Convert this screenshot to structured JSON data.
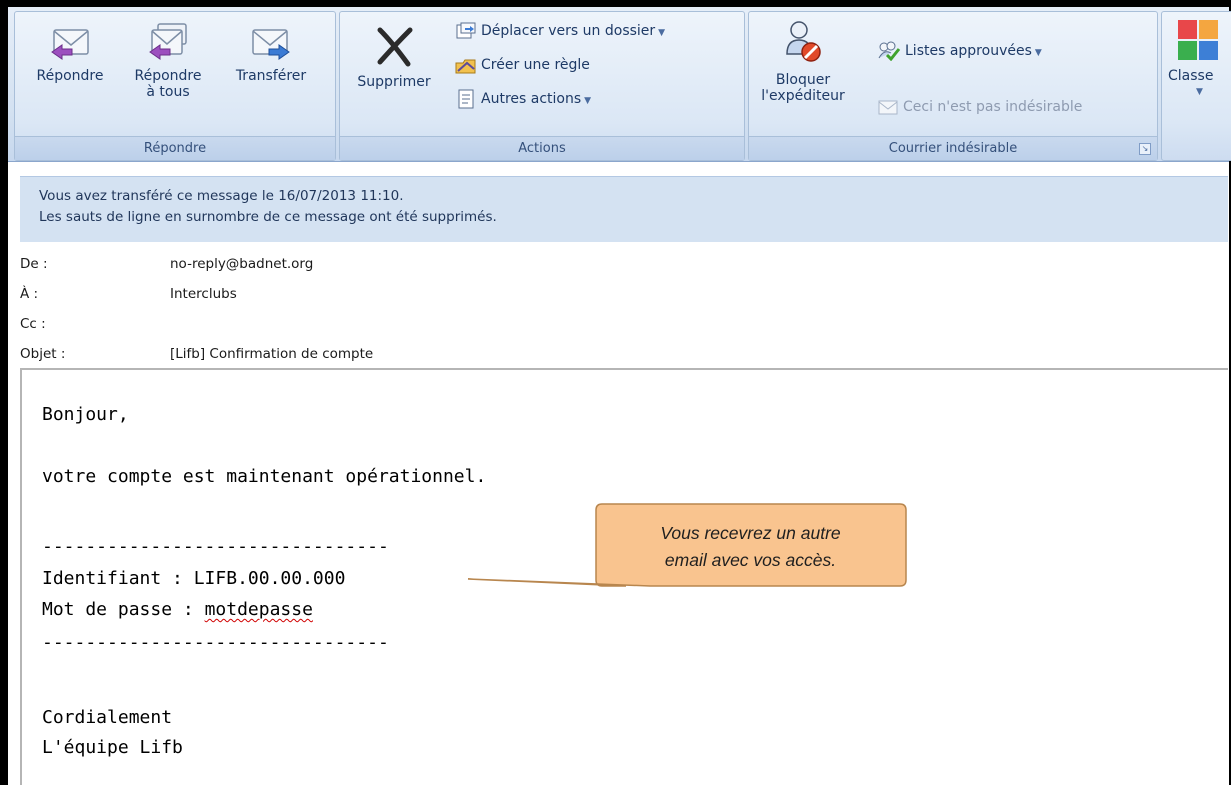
{
  "ribbon": {
    "groups": {
      "respond": {
        "title": "Répondre",
        "reply": "Répondre",
        "reply_all_line1": "Répondre",
        "reply_all_line2": "à tous",
        "forward": "Transférer"
      },
      "actions": {
        "title": "Actions",
        "delete": "Supprimer",
        "move_to_folder": "Déplacer vers un dossier",
        "create_rule": "Créer une règle",
        "other_actions": "Autres actions"
      },
      "junk": {
        "title": "Courrier indésirable",
        "block_sender_line1": "Bloquer",
        "block_sender_line2": "l'expéditeur",
        "safe_lists": "Listes approuvées",
        "not_junk": "Ceci n'est pas indésirable"
      },
      "categorize": {
        "label": "Classe"
      }
    }
  },
  "infobar": {
    "line1": "Vous avez transféré ce message le 16/07/2013 11:10.",
    "line2": "Les sauts de ligne en surnombre de ce message ont été supprimés."
  },
  "headers": {
    "from_label": "De :",
    "from_value": "no-reply@badnet.org",
    "to_label": "À :",
    "to_value": "Interclubs",
    "cc_label": "Cc :",
    "cc_value": "",
    "subject_label": "Objet :",
    "subject_value": "[Lifb] Confirmation de compte"
  },
  "message": {
    "greeting": "Bonjour,",
    "line1": "votre compte est maintenant opérationnel.",
    "separator": "--------------------------------",
    "identifier_line": "Identifiant : LIFB.00.00.000",
    "password_prefix": "Mot de passe : ",
    "password_value": "motdepasse",
    "closing": "Cordialement",
    "signature": "L'équipe Lifb"
  },
  "callout": {
    "line1": "Vous recevrez un autre",
    "line2": "email avec vos accès."
  },
  "colors": {
    "ribbon_bg": "#d3e1f1",
    "infobar_bg": "#d4e2f2",
    "callout_fill": "#f9c48f",
    "callout_border": "#b8864e"
  },
  "icons": {
    "reply": "envelope-reply-icon",
    "reply_all": "envelope-reply-all-icon",
    "forward": "envelope-forward-icon",
    "delete": "x-delete-icon",
    "move": "folder-move-icon",
    "rule": "rule-icon",
    "other": "document-icon",
    "block": "person-block-icon",
    "safe": "people-check-icon",
    "notjunk": "envelope-disabled-icon",
    "categorize": "color-squares-icon"
  }
}
